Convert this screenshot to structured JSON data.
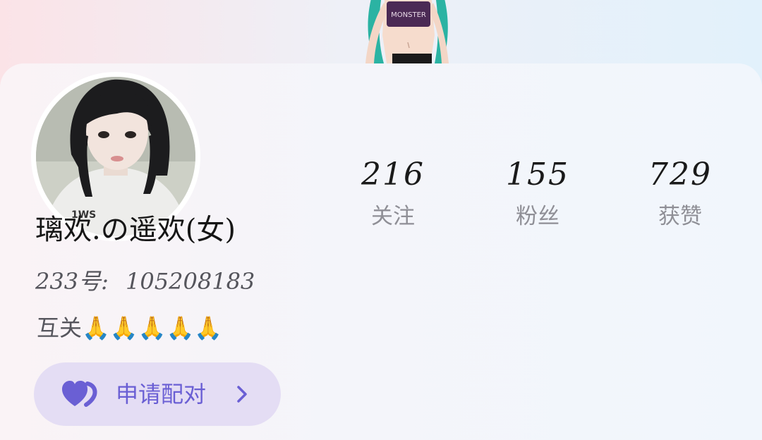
{
  "profile": {
    "nickname": "璃欢.の遥欢(女)",
    "uid_label": "233号:",
    "uid_value": "105208183",
    "bio": "互关🙏🙏🙏🙏🙏"
  },
  "stats": [
    {
      "value": "216",
      "label": "关注"
    },
    {
      "value": "155",
      "label": "粉丝"
    },
    {
      "value": "729",
      "label": "获赞"
    }
  ],
  "pair_button": {
    "label": "申请配对",
    "heart_icon": "heart-pair-icon",
    "chevron_icon": "chevron-right-icon"
  },
  "banner": {
    "figure_text": "MONSTER"
  },
  "colors": {
    "accent": "#6a5fd4",
    "pair_bg": "#e4ddf4",
    "stat_number": "#1a1a1a",
    "stat_label": "#8f8f96"
  }
}
